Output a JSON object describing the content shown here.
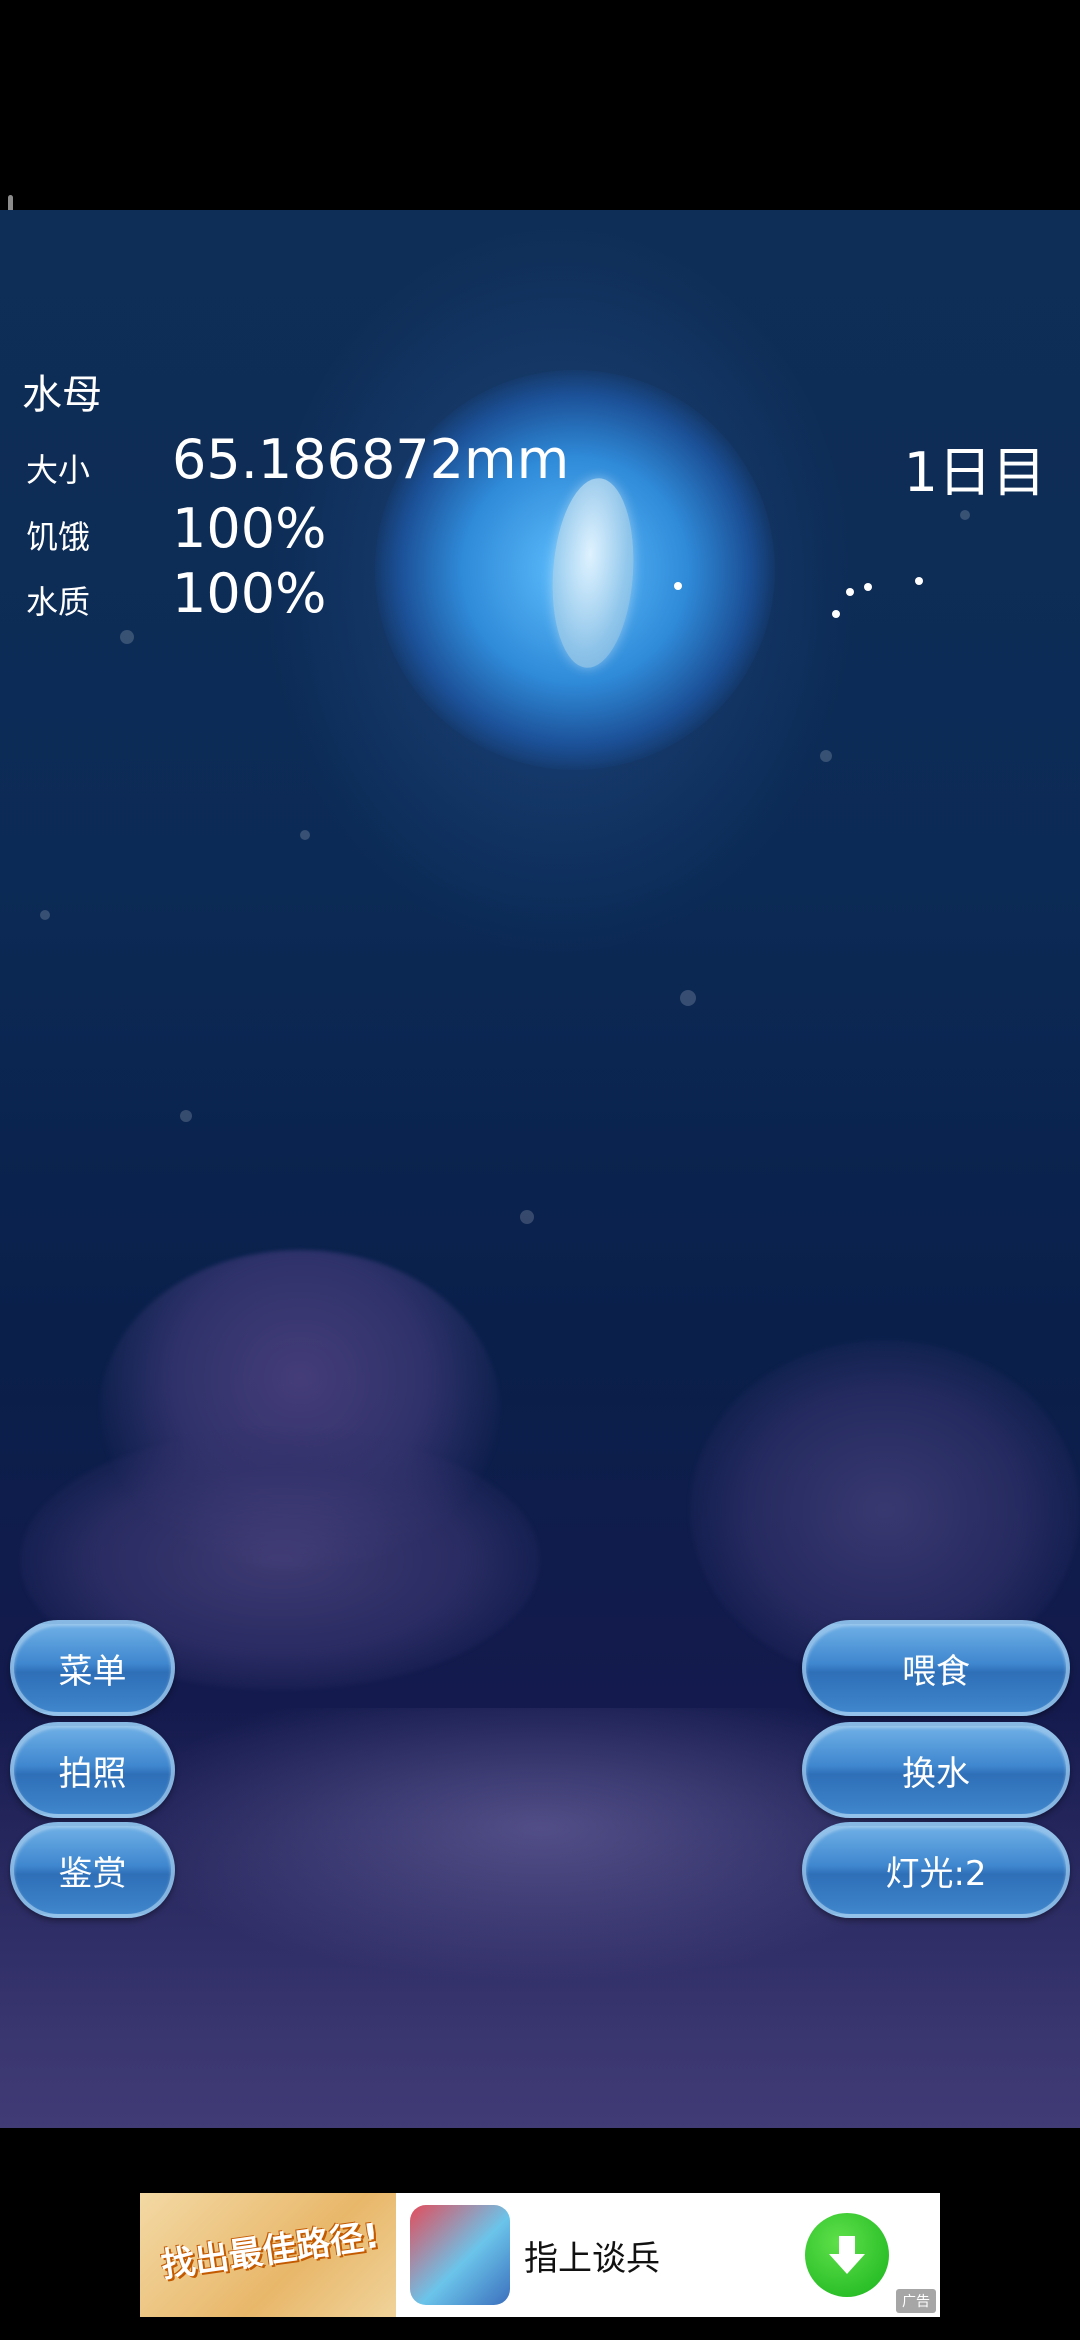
{
  "stats": {
    "title": "水母",
    "size_label": "大小",
    "size_value": "65.186872mm",
    "hunger_label": "饥饿",
    "hunger_value": "100%",
    "water_label": "水质",
    "water_value": "100%",
    "day": "1日目"
  },
  "buttons": {
    "menu": "菜单",
    "photo": "拍照",
    "appreciate": "鉴赏",
    "feed": "喂食",
    "change_water": "换水",
    "light": "灯光:2"
  },
  "ad": {
    "banner_text": "找出最佳路径!",
    "app_name": "指上谈兵",
    "tag": "广告"
  },
  "colors": {
    "button_fill": "#3f87cf",
    "water_deep": "#0a1f4a",
    "glow": "#5fc0ff",
    "download_green": "#18b31c"
  }
}
